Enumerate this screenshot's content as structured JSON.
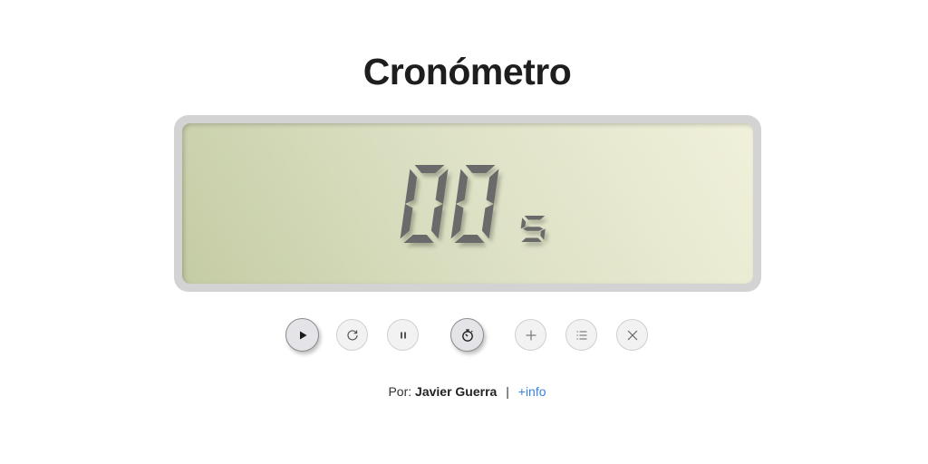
{
  "page": {
    "title": "Cronómetro"
  },
  "display": {
    "digits": "00",
    "unit": "s",
    "lcd_text_color": "#6a6a6a"
  },
  "controls": [
    {
      "name": "play-button",
      "icon": "play-icon",
      "active": true
    },
    {
      "name": "reset-button",
      "icon": "reset-icon",
      "active": false
    },
    {
      "name": "pause-button",
      "icon": "pause-icon",
      "active": false
    },
    {
      "name": "stopwatch-mode-button",
      "icon": "stopwatch-icon",
      "active": true
    },
    {
      "name": "add-button",
      "icon": "plus-icon",
      "active": false
    },
    {
      "name": "laps-list-button",
      "icon": "list-icon",
      "active": false
    },
    {
      "name": "close-button",
      "icon": "close-icon",
      "active": false
    }
  ],
  "footer": {
    "by_label": "Por:",
    "author": "Javier Guerra",
    "separator": "|",
    "info_link": "+info",
    "link_color": "#3b82e0"
  }
}
